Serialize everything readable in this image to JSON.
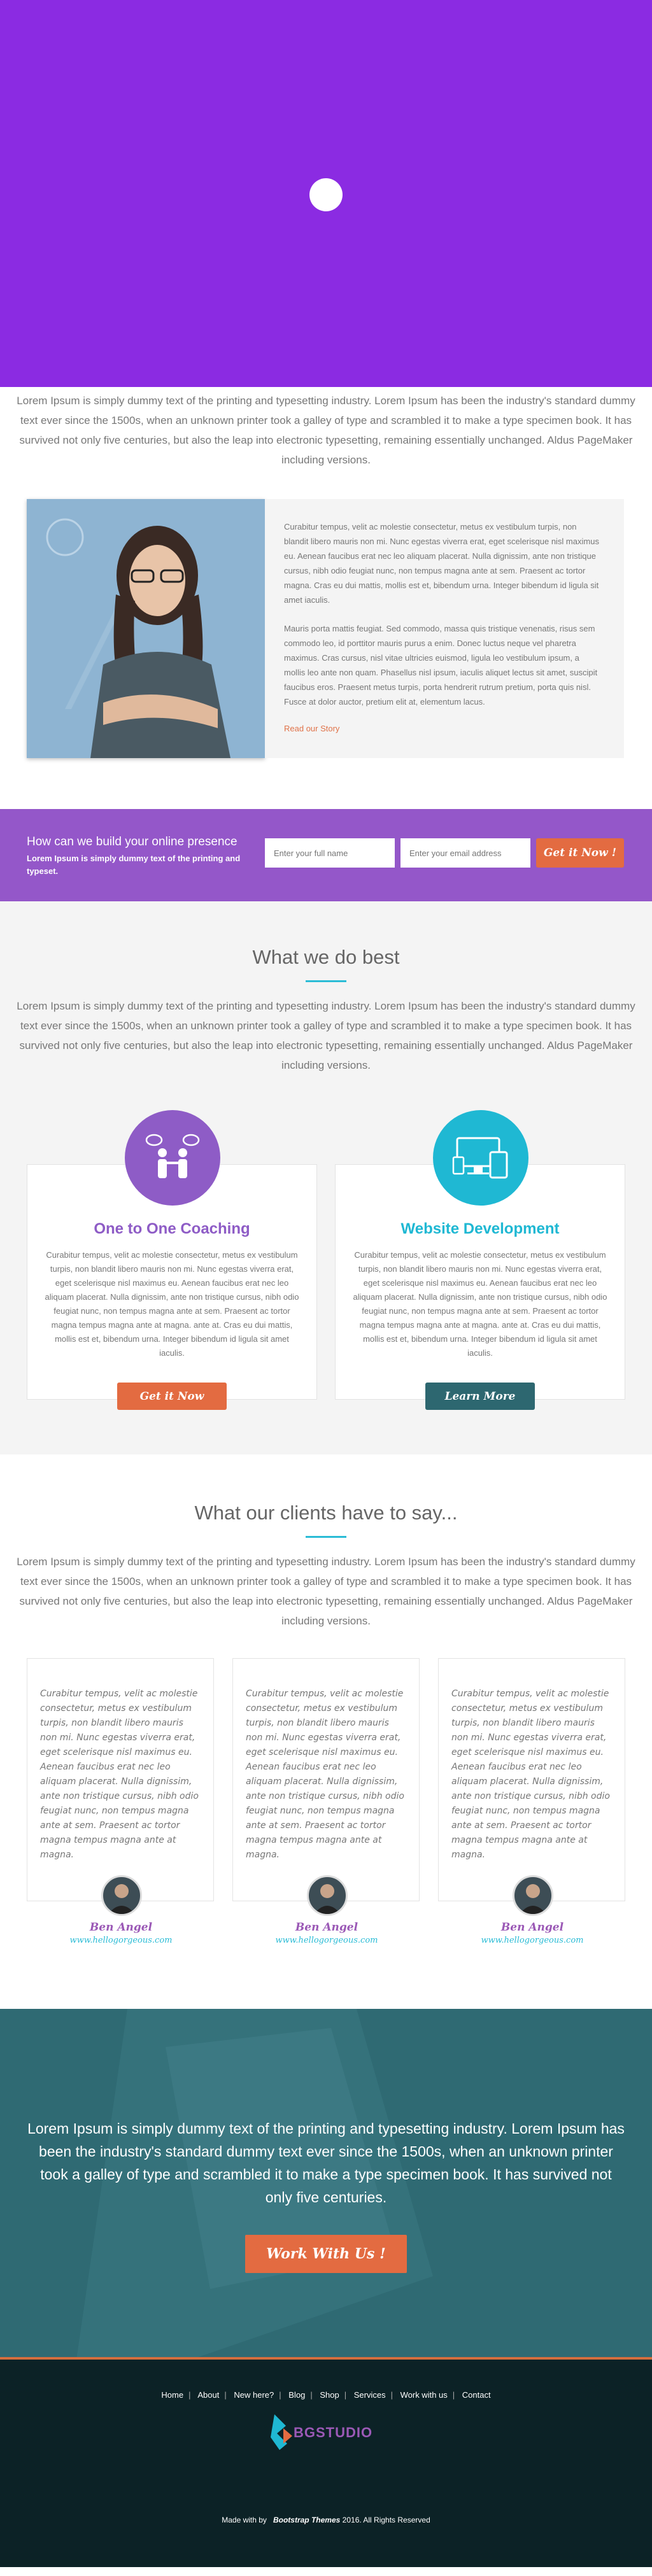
{
  "intro": "Lorem Ipsum is simply dummy text of the printing and typesetting industry. Lorem Ipsum has been the industry's standard dummy text ever since the 1500s, when an unknown printer took a galley of type and scrambled it to make a type specimen book. It has survived not only five centuries, but also the leap into electronic typesetting, remaining essentially unchanged. Aldus PageMaker including versions.",
  "story": {
    "p1": "Curabitur tempus, velit ac molestie consectetur, metus ex vestibulum turpis, non blandit libero mauris non mi. Nunc egestas viverra erat, eget scelerisque nisl maximus eu. Aenean faucibus erat nec leo aliquam placerat. Nulla dignissim, ante non tristique cursus, nibh odio feugiat nunc, non tempus magna ante at sem. Praesent ac tortor magna. Cras eu dui mattis, mollis est et, bibendum urna. Integer bibendum id ligula sit amet iaculis.",
    "p2": "Mauris porta mattis feugiat. Sed commodo, massa quis tristique venenatis, risus sem commodo leo, id porttitor mauris purus a enim. Donec luctus neque vel pharetra maximus. Cras cursus, nisl vitae ultricies euismod, ligula leo vestibulum ipsum, a mollis leo ante non quam. Phasellus nisl ipsum, iaculis aliquet lectus sit amet, suscipit faucibus eros. Praesent metus turpis, porta hendrerit rutrum pretium, porta quis nisl. Fusce at dolor auctor, pretium elit at, elementum lacus.",
    "link": "Read our Story"
  },
  "cta": {
    "title": "How can we build your online presence",
    "subtitle": "Lorem Ipsum is simply dummy text of the printing and typeset.",
    "name_placeholder": "Enter your full name",
    "email_placeholder": "Enter your email address",
    "button": "Get it Now !"
  },
  "services": {
    "title": "What we do best",
    "intro": "Lorem Ipsum is simply dummy text of the printing and typesetting industry. Lorem Ipsum has been the industry's standard dummy text ever since the 1500s, when an unknown printer took a galley of type and scrambled it to make a type specimen book. It has survived not only five centuries, but also the leap into electronic typesetting, remaining essentially unchanged. Aldus PageMaker including versions.",
    "items": [
      {
        "title": "One to One Coaching",
        "text": "Curabitur tempus, velit ac molestie consectetur, metus ex vestibulum turpis, non blandit libero mauris non mi. Nunc egestas viverra erat, eget scelerisque nisl maximus eu. Aenean faucibus erat nec leo aliquam placerat. Nulla dignissim, ante non tristique cursus, nibh odio feugiat nunc, non tempus magna ante at sem. Praesent ac tortor magna tempus magna ante at magna. ante at. Cras eu dui mattis, mollis est et, bibendum urna. Integer bibendum id ligula sit amet iaculis.",
        "button": "Get it Now",
        "color": "#8e5cc6",
        "button_color": "#e36b41"
      },
      {
        "title": "Website Development",
        "text": "Curabitur tempus, velit ac molestie consectetur, metus ex vestibulum turpis, non blandit libero mauris non mi. Nunc egestas viverra erat, eget scelerisque nisl maximus eu. Aenean faucibus erat nec leo aliquam placerat. Nulla dignissim, ante non tristique cursus, nibh odio feugiat nunc, non tempus magna ante at sem. Praesent ac tortor magna tempus magna ante at magna. ante at. Cras eu dui mattis, mollis est et, bibendum urna. Integer bibendum id ligula sit amet iaculis.",
        "button": "Learn More",
        "color": "#1fb8d3",
        "button_color": "#2d6770"
      }
    ]
  },
  "clients": {
    "title": "What our clients have to say...",
    "intro": "Lorem Ipsum is simply dummy text of the printing and typesetting industry. Lorem Ipsum has been the industry's standard dummy text ever since the 1500s, when an unknown printer took a galley of type and scrambled it to make a type specimen book. It has survived not only five centuries, but also the leap into electronic typesetting, remaining essentially unchanged. Aldus PageMaker including versions.",
    "testimonials": [
      {
        "quote": "Curabitur tempus, velit ac molestie consectetur, metus ex vestibulum turpis, non blandit libero mauris non mi. Nunc egestas viverra erat, eget scelerisque nisl maximus eu. Aenean faucibus erat nec leo aliquam placerat. Nulla dignissim, ante non tristique cursus, nibh odio feugiat nunc, non tempus magna ante at sem. Praesent ac tortor magna tempus magna ante at magna.",
        "name": "Ben Angel",
        "site": "www.hellogorgeous.com"
      },
      {
        "quote": "Curabitur tempus, velit ac molestie consectetur, metus ex vestibulum turpis, non blandit libero mauris non mi. Nunc egestas viverra erat, eget scelerisque nisl maximus eu. Aenean faucibus erat nec leo aliquam placerat. Nulla dignissim, ante non tristique cursus, nibh odio feugiat nunc, non tempus magna ante at sem. Praesent ac tortor magna tempus magna ante at magna.",
        "name": "Ben Angel",
        "site": "www.hellogorgeous.com"
      },
      {
        "quote": "Curabitur tempus, velit ac molestie consectetur, metus ex vestibulum turpis, non blandit libero mauris non mi. Nunc egestas viverra erat, eget scelerisque nisl maximus eu. Aenean faucibus erat nec leo aliquam placerat. Nulla dignissim, ante non tristique cursus, nibh odio feugiat nunc, non tempus magna ante at sem. Praesent ac tortor magna tempus magna ante at magna.",
        "name": "Ben Angel",
        "site": "www.hellogorgeous.com"
      }
    ]
  },
  "banner": {
    "text": "Lorem Ipsum is simply dummy text of the printing and typesetting industry. Lorem Ipsum has been the industry's standard dummy text ever since the 1500s, when an unknown printer took a galley of type and scrambled it to make a type specimen book. It has survived not only five centuries.",
    "button": "Work With Us !"
  },
  "footer": {
    "nav": [
      "Home",
      "About",
      "New here?",
      "Blog",
      "Shop",
      "Services",
      "Work with us",
      "Contact"
    ],
    "logo_text": "BGSTUDIO",
    "made_with": "Made with by",
    "brand": "Bootstrap Themes",
    "year_text": "2016. All Rights Reserved"
  },
  "colors": {
    "hero": "#8b2be2",
    "cta": "#9457c9",
    "accent": "#e36b41",
    "teal": "#2bbcd6"
  }
}
